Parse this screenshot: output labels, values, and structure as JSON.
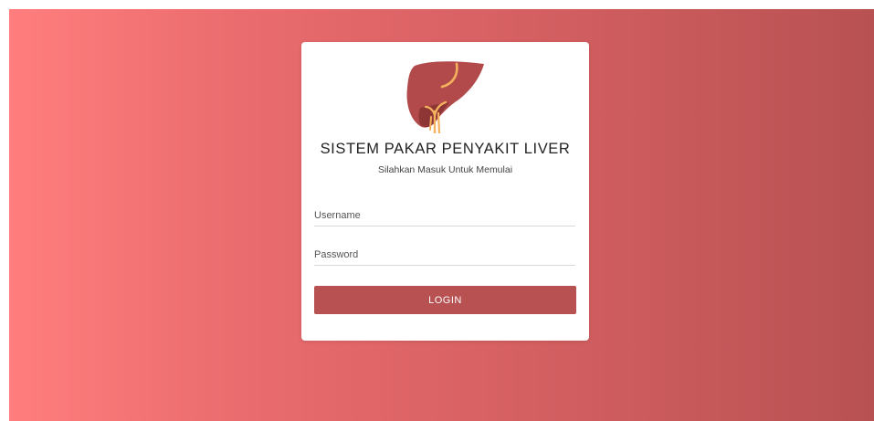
{
  "login": {
    "logo_icon": "liver-icon",
    "title": "SISTEM PAKAR PENYAKIT LIVER",
    "subtitle": "Silahkan Masuk Untuk Memulai",
    "username": {
      "placeholder": "Username",
      "value": ""
    },
    "password": {
      "placeholder": "Password",
      "value": ""
    },
    "login_label": "LOGIN"
  },
  "colors": {
    "background_start": "#ff7d7d",
    "background_end": "#b85152",
    "button": "#b85152",
    "liver": "#b24a4b",
    "liver_dark": "#8e3536",
    "vessel": "#f4b25c"
  }
}
